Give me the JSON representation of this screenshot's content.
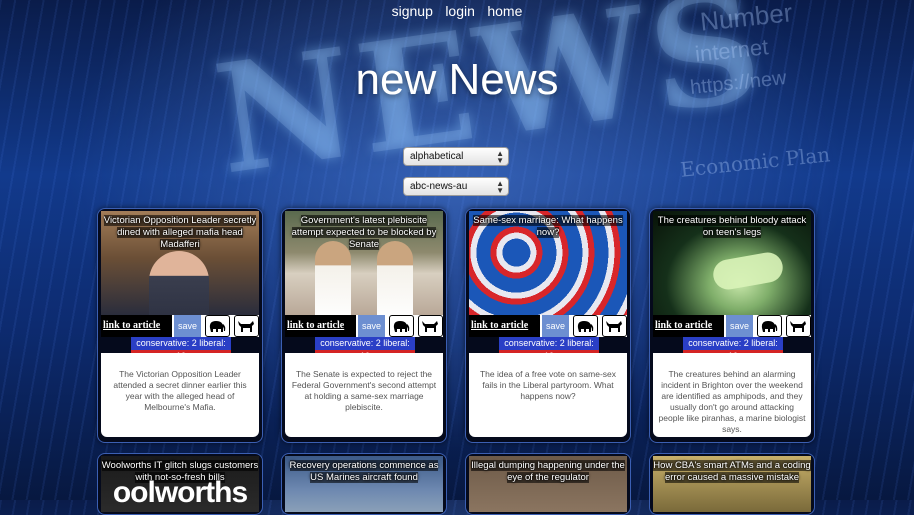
{
  "nav": {
    "signup": "signup",
    "login": "login",
    "home": "home"
  },
  "title": "new News",
  "background": {
    "word": "NEWS",
    "t1": "Number",
    "t2": "internet",
    "t3": "https://new",
    "t4": "Economic Plan"
  },
  "controls": {
    "sort_select": "alphabetical",
    "source_select": "abc-news-au"
  },
  "labels": {
    "link": "link to article",
    "save": "save"
  },
  "articles": [
    {
      "headline": "Victorian Opposition Leader secretly dined with alleged mafia head Madafferi",
      "score": "conservative: 2 liberal: 10",
      "summary": "The Victorian Opposition Leader attended a secret dinner earlier this year with the alleged head of Melbourne's Mafia."
    },
    {
      "headline": "Government's latest plebiscite attempt expected to be blocked by Senate",
      "score": "conservative: 2 liberal: 10",
      "summary": "The Senate is expected to reject the Federal Government's second attempt at holding a same-sex marriage plebiscite."
    },
    {
      "headline": "Same-sex marriage: What happens now?",
      "score": "conservative: 2 liberal: 10",
      "summary": "The idea of a free vote on same-sex fails in the Liberal partyroom. What happens now?"
    },
    {
      "headline": "The creatures behind bloody attack on teen's legs",
      "score": "conservative: 2 liberal: 10",
      "summary": "The creatures behind an alarming incident in Brighton over the weekend are identified as amphipods, and they usually don't go around attacking people like piranhas, a marine biologist says."
    },
    {
      "headline": "Woolworths IT glitch slugs customers with not-so-fresh bills",
      "logo": "oolworths"
    },
    {
      "headline": "Recovery operations commence as US Marines aircraft found"
    },
    {
      "headline": "Illegal dumping happening under the eye of the regulator"
    },
    {
      "headline": "How CBA's smart ATMs and a coding error caused a massive mistake"
    }
  ],
  "icons": {
    "elephant": "elephant-icon",
    "donkey": "donkey-icon"
  }
}
